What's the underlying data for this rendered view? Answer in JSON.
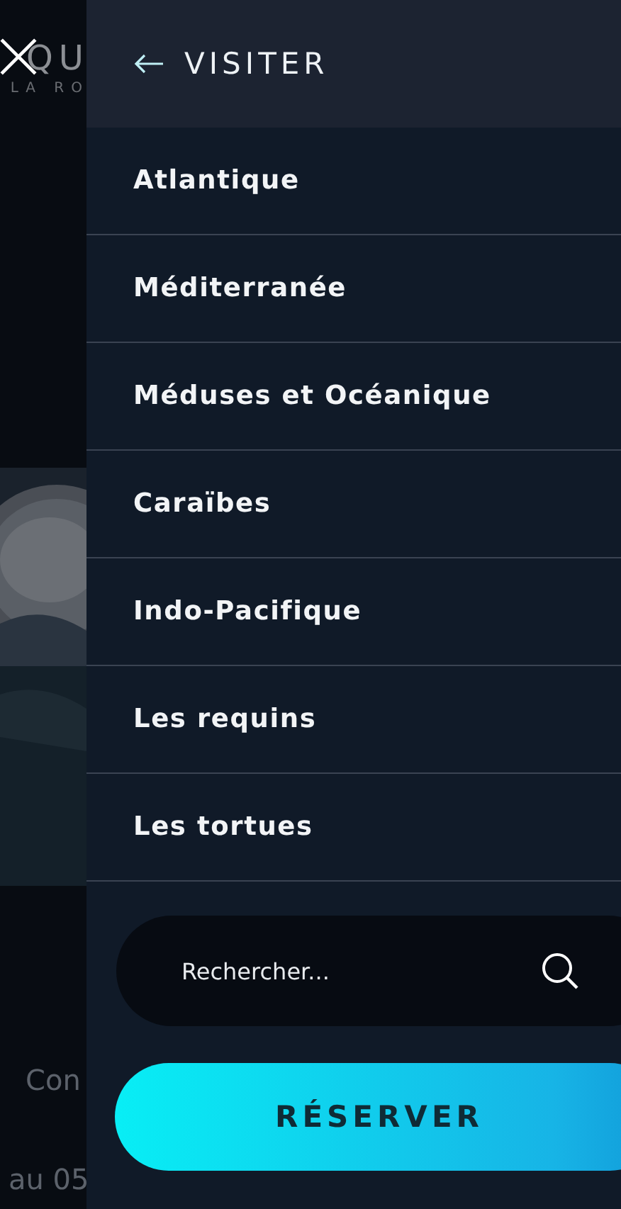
{
  "background": {
    "logo_top": "QU",
    "logo_bottom": "LA RO",
    "texts": [
      "Con",
      "au 05"
    ]
  },
  "menu": {
    "title": "VISITER",
    "items": [
      {
        "label": "Atlantique"
      },
      {
        "label": "Méditerranée"
      },
      {
        "label": "Méduses et Océanique"
      },
      {
        "label": "Caraïbes"
      },
      {
        "label": "Indo-Pacifique"
      },
      {
        "label": "Les requins"
      },
      {
        "label": "Les tortues"
      }
    ]
  },
  "search": {
    "placeholder": "Rechercher..."
  },
  "button": {
    "label": "RÉSERVER"
  }
}
